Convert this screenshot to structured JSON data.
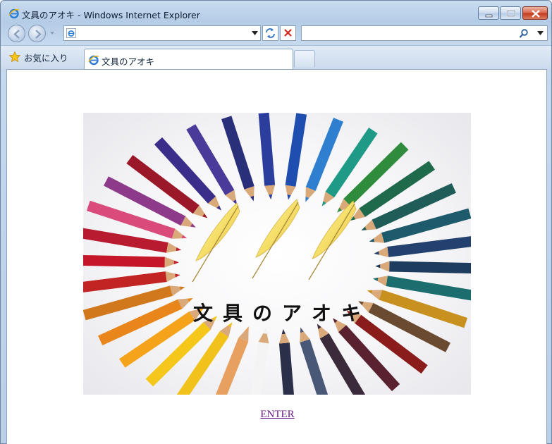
{
  "window": {
    "title": "文具のアオキ - Windows Internet Explorer",
    "buttons": {
      "minimize": "minimize-icon",
      "maximize": "maximize-icon",
      "close": "close-icon"
    }
  },
  "nav": {
    "address_value": "",
    "search_value": "",
    "icons": [
      "back-arrow-icon",
      "forward-arrow-icon",
      "refresh-icon",
      "stop-icon",
      "search-icon"
    ]
  },
  "tabs": {
    "favorites_label": "お気に入り",
    "active_tab_label": "文具のアオキ"
  },
  "page": {
    "banner_title": "文具のアオキ",
    "banner_image": "colored-pencils-with-feathers",
    "enter_link": "ENTER"
  },
  "colors": {
    "link_visited": "#6a1b8a",
    "close_button": "#c2381b",
    "chrome": "#c5d9ee"
  }
}
